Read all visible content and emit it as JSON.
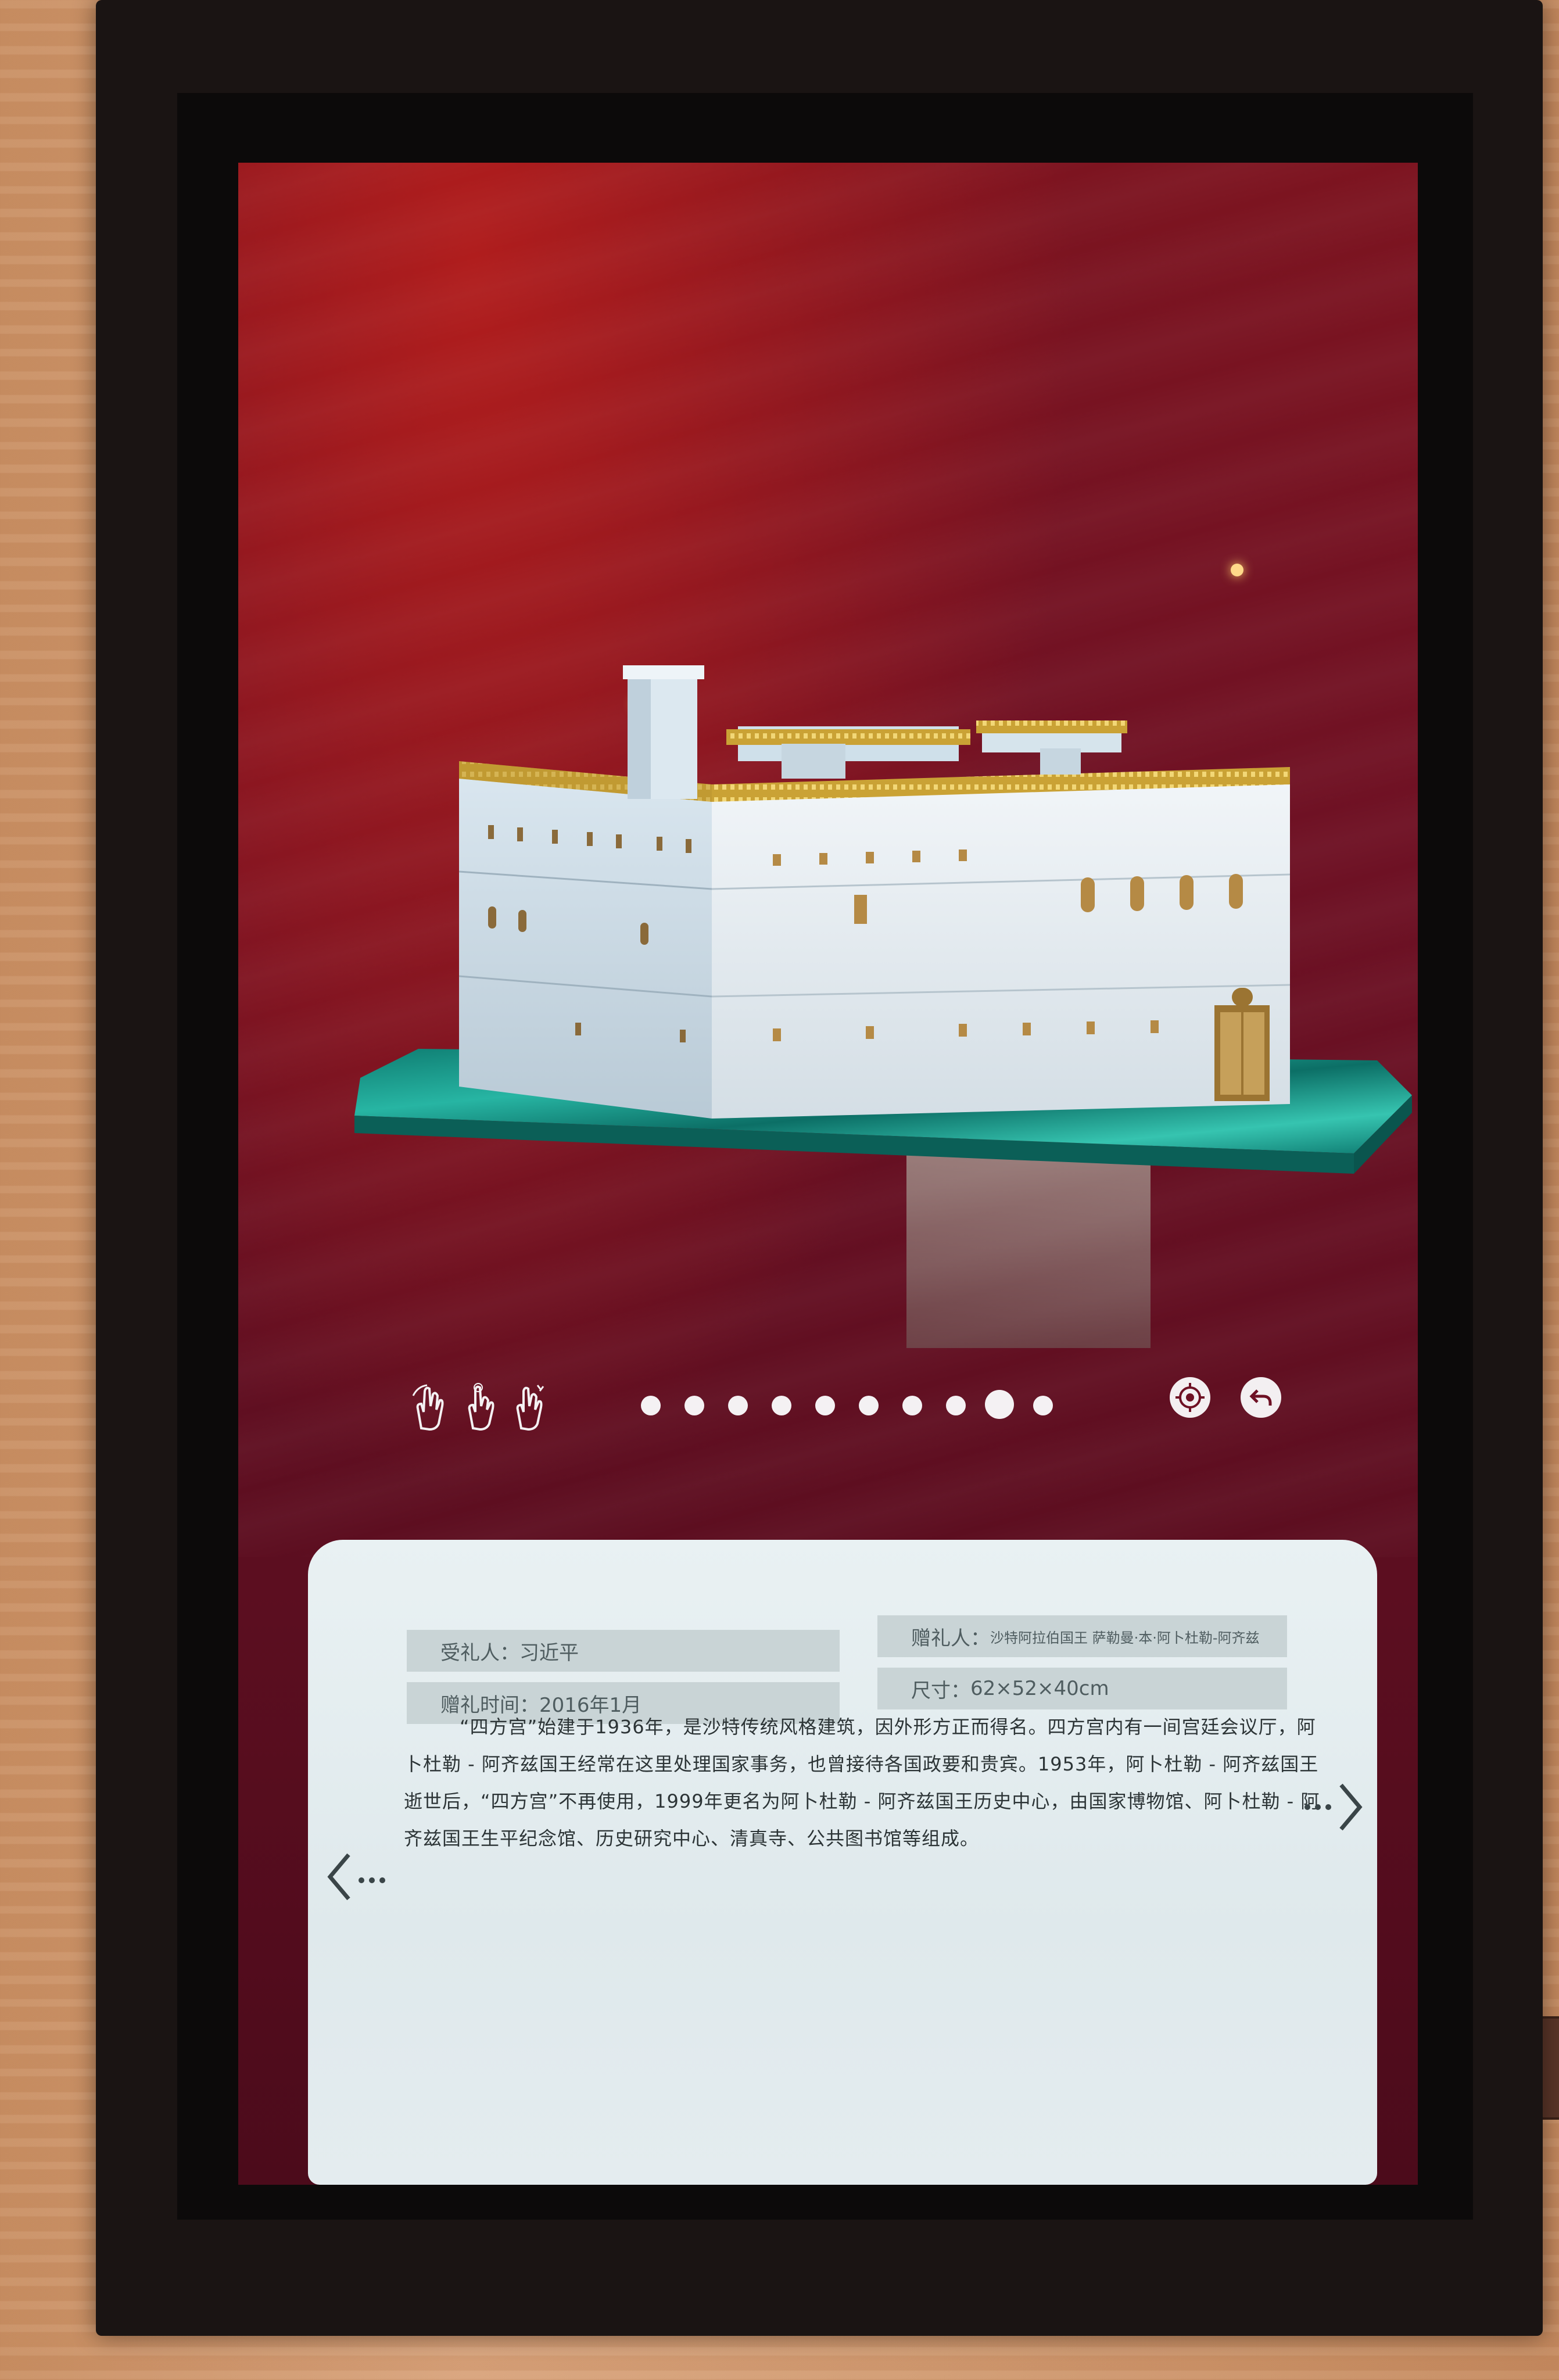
{
  "info": {
    "recipient_label": "受礼人：",
    "recipient_value": "习近平",
    "gift_time_label": "赠礼时间：",
    "gift_time_value": "2016年1月",
    "giver_label": "赠礼人：",
    "giver_value": "沙特阿拉伯国王 萨勒曼·本·阿卜杜勒-阿齐兹",
    "size_label": "尺寸：",
    "size_value": "62×52×40cm",
    "description": "“四方宫”始建于1936年，是沙特传统风格建筑，因外形方正而得名。四方宫内有一间宫廷会议厅，阿卜杜勒 - 阿齐兹国王经常在这里处理国家事务，也曾接待各国政要和贵宾。1953年，阿卜杜勒 - 阿齐兹国王逝世后，“四方宫”不再使用，1999年更名为阿卜杜勒 - 阿齐兹国王历史中心，由国家博物馆、阿卜杜勒 - 阿齐兹国王生平纪念馆、历史研究中心、清真寺、公共图书馆等组成。"
  },
  "pagination": {
    "total": 10,
    "current_index": 8
  },
  "icons": {
    "gestures": [
      "hand-rotate-icon",
      "hand-tap-icon",
      "hand-pinch-icon"
    ],
    "reset": "reset-view-icon",
    "back": "back-icon",
    "prev": "prev-arrow-icon",
    "next": "next-arrow-icon"
  },
  "colors": {
    "screen_bg": "#6e1124",
    "panel_bg": "#e4ecef",
    "field_bg": "#c9d4d6",
    "malachite": "#1a9c8c",
    "gold_trim": "#d8b23c",
    "building_white": "#e8eef3"
  }
}
